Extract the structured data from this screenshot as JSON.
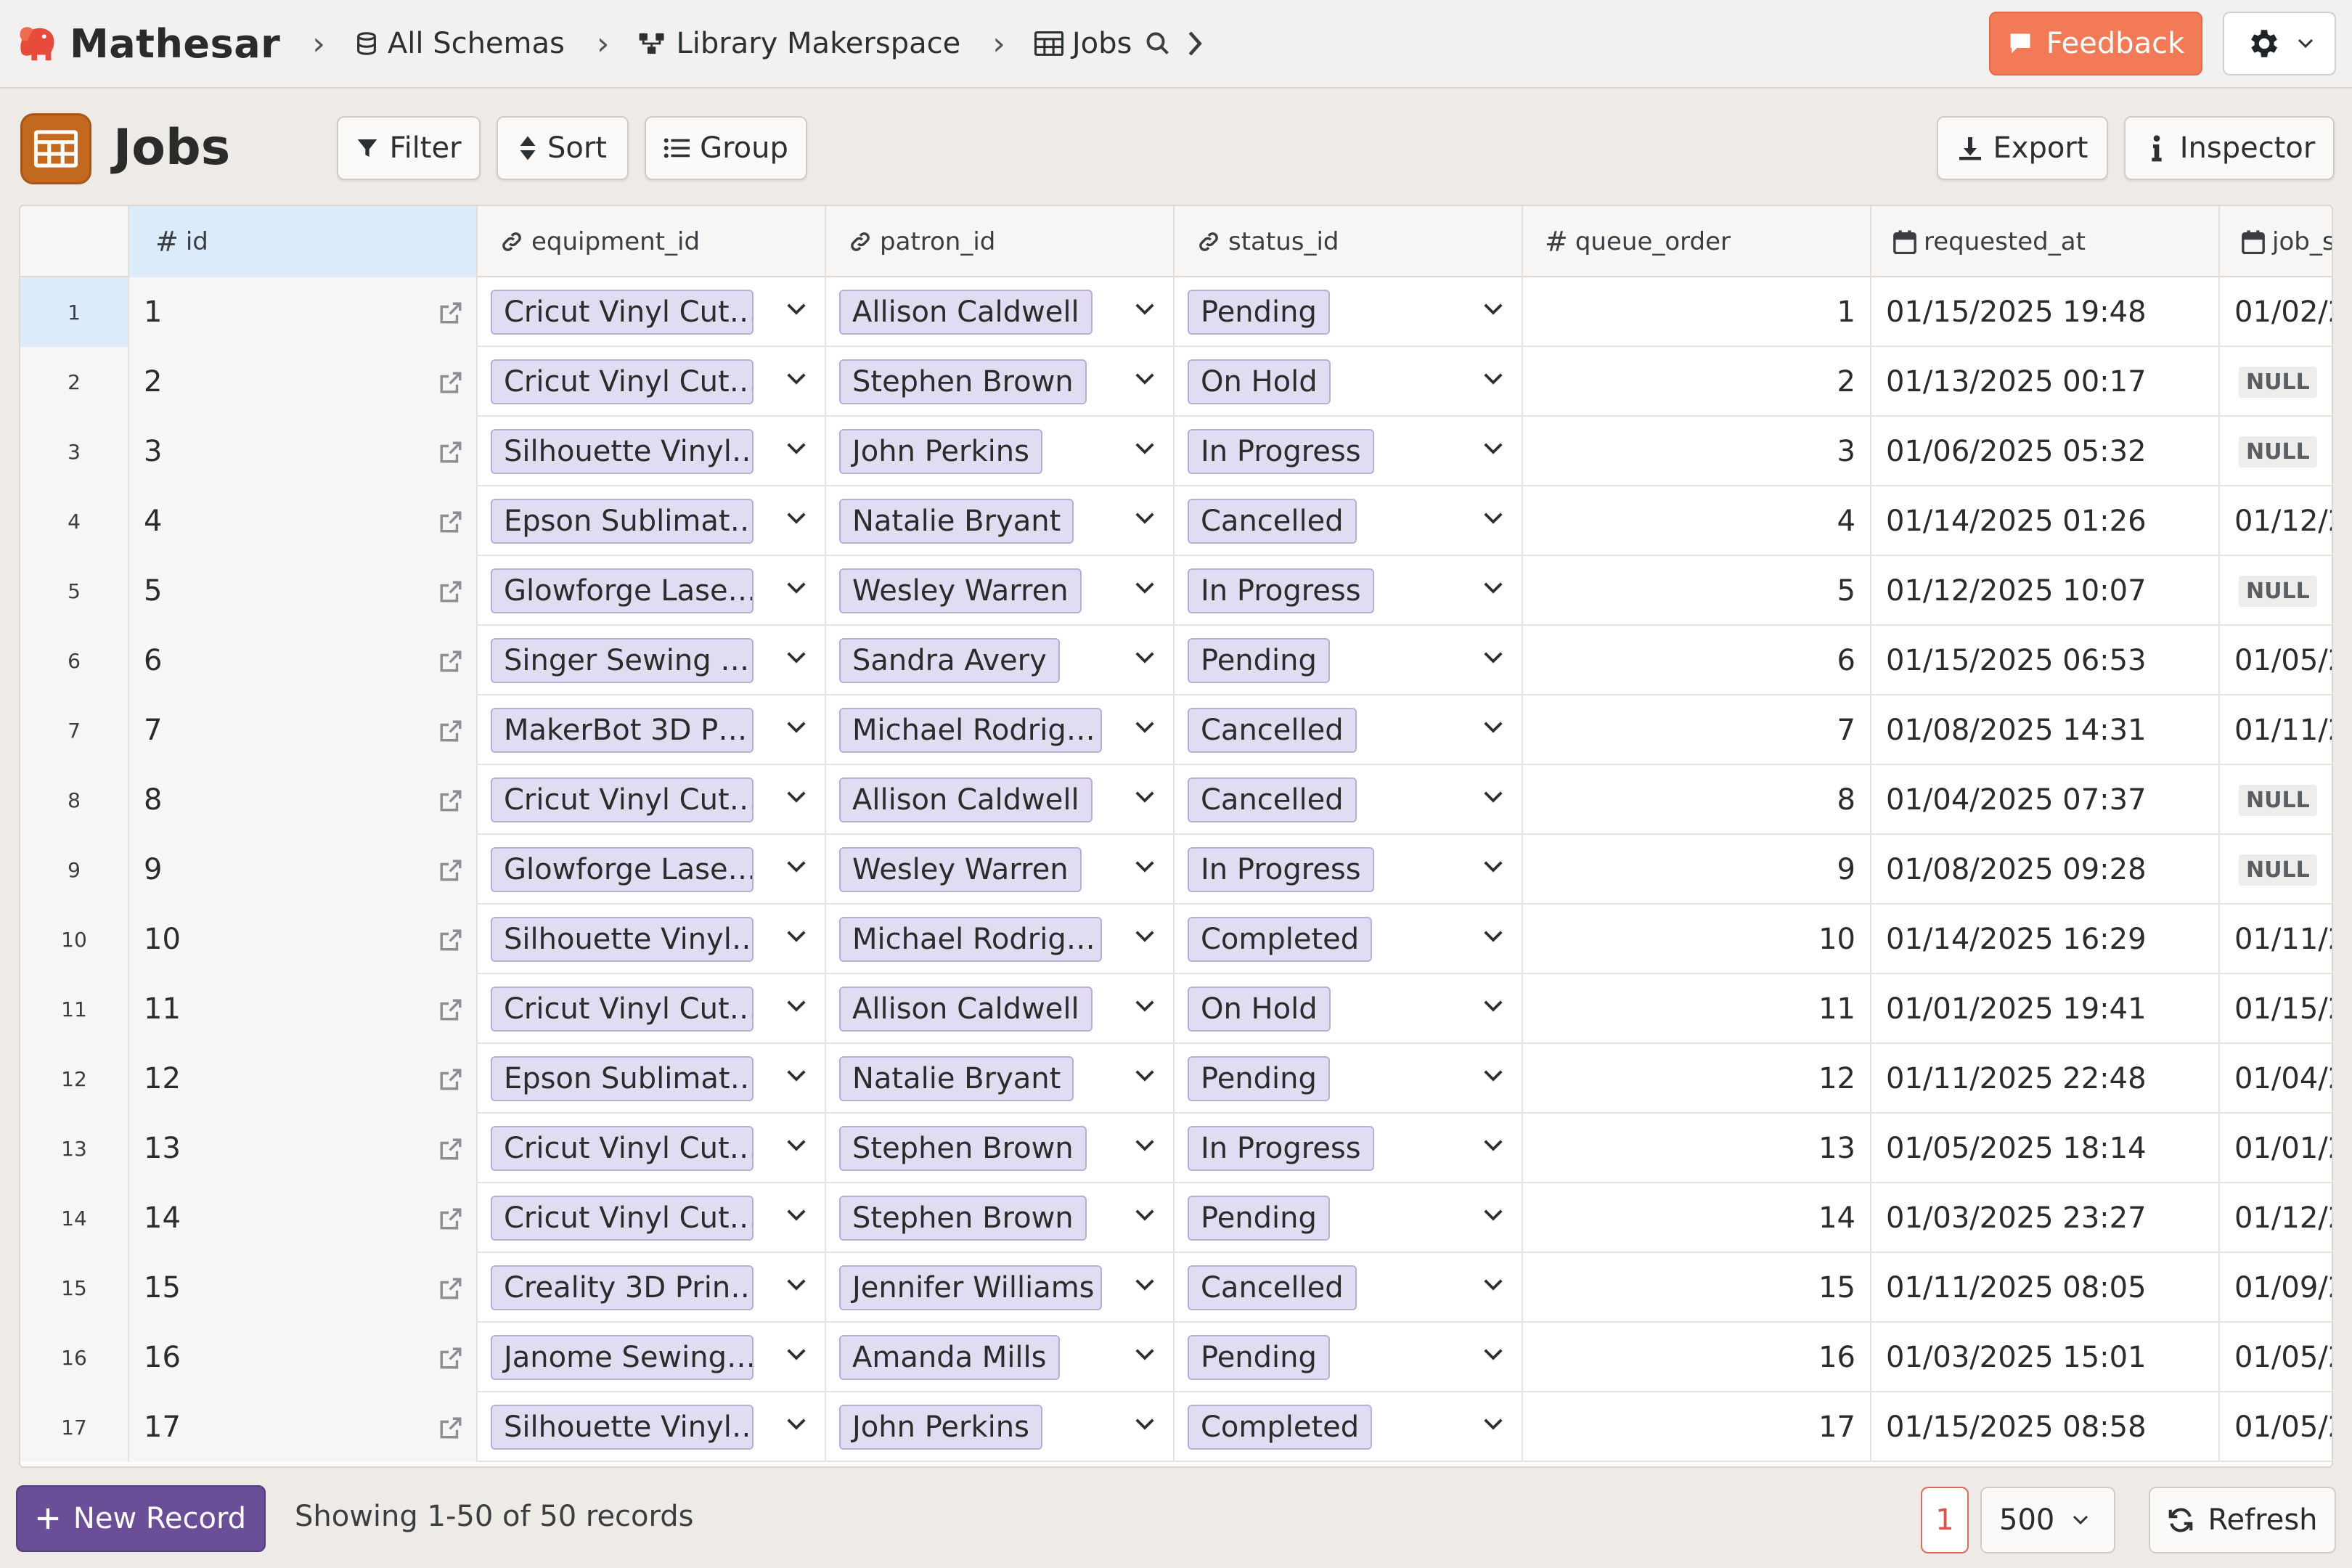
{
  "app": {
    "name": "Mathesar"
  },
  "breadcrumbs": [
    {
      "label": "All Schemas",
      "icon": "database-icon"
    },
    {
      "label": "Library Makerspace",
      "icon": "schema-icon"
    },
    {
      "label": "Jobs",
      "icon": "table-icon"
    }
  ],
  "header": {
    "feedback_label": "Feedback"
  },
  "table": {
    "title": "Jobs",
    "toolbar": {
      "filter": "Filter",
      "sort": "Sort",
      "group": "Group",
      "export": "Export",
      "inspector": "Inspector"
    },
    "columns": [
      {
        "name": "id",
        "type": "number"
      },
      {
        "name": "equipment_id",
        "type": "link"
      },
      {
        "name": "patron_id",
        "type": "link"
      },
      {
        "name": "status_id",
        "type": "link"
      },
      {
        "name": "queue_order",
        "type": "number"
      },
      {
        "name": "requested_at",
        "type": "date"
      },
      {
        "name": "job_s",
        "type": "date"
      }
    ],
    "rows": [
      {
        "n": "1",
        "id": "1",
        "equipment": "Cricut Vinyl Cut…",
        "patron": "Allison Caldwell",
        "status": "Pending",
        "queue": "1",
        "requested": "01/15/2025 19:48",
        "job": "01/02/2",
        "job_null": false
      },
      {
        "n": "2",
        "id": "2",
        "equipment": "Cricut Vinyl Cut…",
        "patron": "Stephen Brown",
        "status": "On Hold",
        "queue": "2",
        "requested": "01/13/2025 00:17",
        "job": "NULL",
        "job_null": true
      },
      {
        "n": "3",
        "id": "3",
        "equipment": "Silhouette Vinyl…",
        "patron": "John Perkins",
        "status": "In Progress",
        "queue": "3",
        "requested": "01/06/2025 05:32",
        "job": "NULL",
        "job_null": true
      },
      {
        "n": "4",
        "id": "4",
        "equipment": "Epson Sublimat…",
        "patron": "Natalie Bryant",
        "status": "Cancelled",
        "queue": "4",
        "requested": "01/14/2025 01:26",
        "job": "01/12/2",
        "job_null": false
      },
      {
        "n": "5",
        "id": "5",
        "equipment": "Glowforge Lase…",
        "patron": "Wesley Warren",
        "status": "In Progress",
        "queue": "5",
        "requested": "01/12/2025 10:07",
        "job": "NULL",
        "job_null": true
      },
      {
        "n": "6",
        "id": "6",
        "equipment": "Singer Sewing …",
        "patron": "Sandra Avery",
        "status": "Pending",
        "queue": "6",
        "requested": "01/15/2025 06:53",
        "job": "01/05/2",
        "job_null": false
      },
      {
        "n": "7",
        "id": "7",
        "equipment": "MakerBot 3D P…",
        "patron": "Michael Rodrig…",
        "status": "Cancelled",
        "queue": "7",
        "requested": "01/08/2025 14:31",
        "job": "01/11/2",
        "job_null": false
      },
      {
        "n": "8",
        "id": "8",
        "equipment": "Cricut Vinyl Cut…",
        "patron": "Allison Caldwell",
        "status": "Cancelled",
        "queue": "8",
        "requested": "01/04/2025 07:37",
        "job": "NULL",
        "job_null": true
      },
      {
        "n": "9",
        "id": "9",
        "equipment": "Glowforge Lase…",
        "patron": "Wesley Warren",
        "status": "In Progress",
        "queue": "9",
        "requested": "01/08/2025 09:28",
        "job": "NULL",
        "job_null": true
      },
      {
        "n": "10",
        "id": "10",
        "equipment": "Silhouette Vinyl…",
        "patron": "Michael Rodrig…",
        "status": "Completed",
        "queue": "10",
        "requested": "01/14/2025 16:29",
        "job": "01/11/2",
        "job_null": false
      },
      {
        "n": "11",
        "id": "11",
        "equipment": "Cricut Vinyl Cut…",
        "patron": "Allison Caldwell",
        "status": "On Hold",
        "queue": "11",
        "requested": "01/01/2025 19:41",
        "job": "01/15/2",
        "job_null": false
      },
      {
        "n": "12",
        "id": "12",
        "equipment": "Epson Sublimat…",
        "patron": "Natalie Bryant",
        "status": "Pending",
        "queue": "12",
        "requested": "01/11/2025 22:48",
        "job": "01/04/2",
        "job_null": false
      },
      {
        "n": "13",
        "id": "13",
        "equipment": "Cricut Vinyl Cut…",
        "patron": "Stephen Brown",
        "status": "In Progress",
        "queue": "13",
        "requested": "01/05/2025 18:14",
        "job": "01/01/2",
        "job_null": false
      },
      {
        "n": "14",
        "id": "14",
        "equipment": "Cricut Vinyl Cut…",
        "patron": "Stephen Brown",
        "status": "Pending",
        "queue": "14",
        "requested": "01/03/2025 23:27",
        "job": "01/12/2",
        "job_null": false
      },
      {
        "n": "15",
        "id": "15",
        "equipment": "Creality 3D Prin…",
        "patron": "Jennifer Williams",
        "status": "Cancelled",
        "queue": "15",
        "requested": "01/11/2025 08:05",
        "job": "01/09/2",
        "job_null": false
      },
      {
        "n": "16",
        "id": "16",
        "equipment": "Janome Sewing…",
        "patron": "Amanda Mills",
        "status": "Pending",
        "queue": "16",
        "requested": "01/03/2025 15:01",
        "job": "01/05/2",
        "job_null": false
      },
      {
        "n": "17",
        "id": "17",
        "equipment": "Silhouette Vinyl…",
        "patron": "John Perkins",
        "status": "Completed",
        "queue": "17",
        "requested": "01/15/2025 08:58",
        "job": "01/05/2",
        "job_null": false
      }
    ]
  },
  "footer": {
    "new_record": "New Record",
    "showing": "Showing 1-50 of 50 records",
    "page": "1",
    "page_size": "500",
    "refresh": "Refresh"
  },
  "colors": {
    "brand": "#f37a56",
    "accent_purple": "#6a4f98",
    "chip_bg": "#e2dcf2",
    "selected_bg": "#dcebfa"
  }
}
